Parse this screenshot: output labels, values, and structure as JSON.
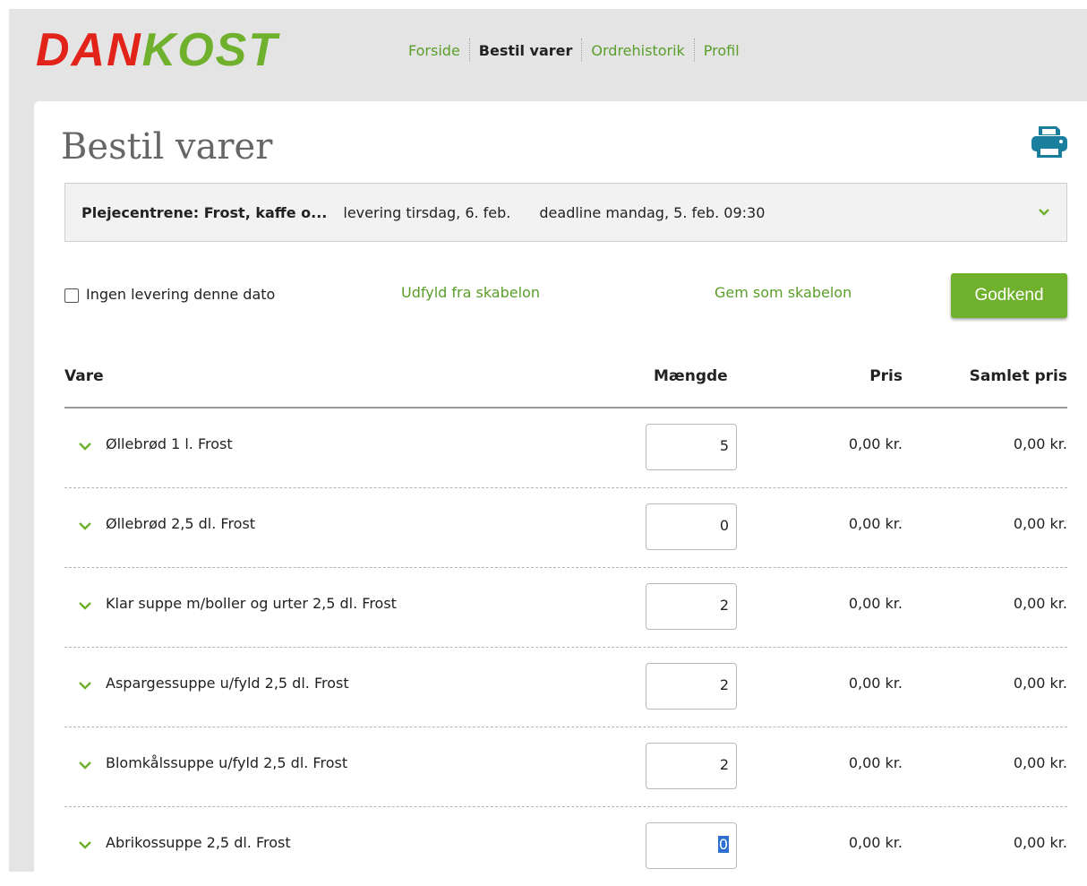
{
  "brand": {
    "part1": "DAN",
    "part2": "KOST"
  },
  "nav": [
    {
      "label": "Forside",
      "active": false
    },
    {
      "label": "Bestil varer",
      "active": true
    },
    {
      "label": "Ordrehistorik",
      "active": false
    },
    {
      "label": "Profil",
      "active": false
    }
  ],
  "page": {
    "title": "Bestil varer"
  },
  "delivery": {
    "group": "Plejecentrene: Frost, kaffe o...",
    "delivery_date": "levering tirsdag, 6. feb.",
    "deadline": "deadline mandag, 5. feb. 09:30"
  },
  "actions": {
    "no_delivery_label": "Ingen levering denne dato",
    "no_delivery_checked": false,
    "fill_template": "Udfyld fra skabelon",
    "save_template": "Gem som skabelon",
    "approve": "Godkend"
  },
  "table": {
    "headers": {
      "item": "Vare",
      "qty": "Mængde",
      "price": "Pris",
      "total": "Samlet pris"
    },
    "rows": [
      {
        "name": "Øllebrød 1 l. Frost",
        "qty": "5",
        "price": "0,00 kr.",
        "total": "0,00 kr."
      },
      {
        "name": "Øllebrød 2,5 dl. Frost",
        "qty": "0",
        "price": "0,00 kr.",
        "total": "0,00 kr."
      },
      {
        "name": "Klar suppe m/boller og urter 2,5 dl. Frost",
        "qty": "2",
        "price": "0,00 kr.",
        "total": "0,00 kr."
      },
      {
        "name": "Aspargessuppe u/fyld 2,5 dl. Frost",
        "qty": "2",
        "price": "0,00 kr.",
        "total": "0,00 kr."
      },
      {
        "name": "Blomkålssuppe u/fyld 2,5 dl. Frost",
        "qty": "2",
        "price": "0,00 kr.",
        "total": "0,00 kr."
      },
      {
        "name": "Abrikossuppe 2,5 dl. Frost",
        "qty": "0",
        "price": "0,00 kr.",
        "total": "0,00 kr.",
        "focused": true
      }
    ]
  },
  "colors": {
    "brand_red": "#e2231a",
    "brand_green": "#6fb02c",
    "link_green": "#5a9e2a",
    "print_blue": "#1a7f9c"
  },
  "icons": {
    "print": "printer-icon",
    "expand": "chevron-down-icon"
  }
}
